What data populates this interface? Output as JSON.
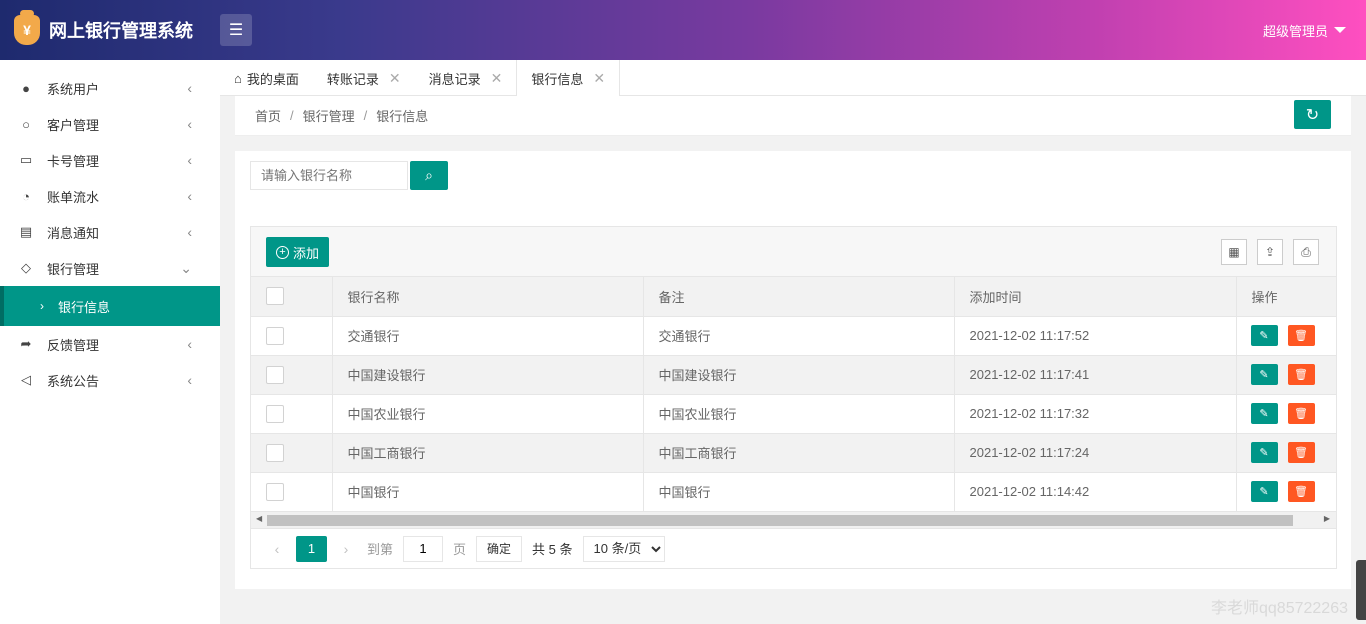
{
  "app": {
    "title": "网上银行管理系统",
    "logo_glyph": "¥"
  },
  "header": {
    "user_label": "超级管理员",
    "menu_icon": "hamburger-icon"
  },
  "sidebar": {
    "items": [
      {
        "label": "系统用户",
        "icon": "user-icon"
      },
      {
        "label": "客户管理",
        "icon": "customer-icon"
      },
      {
        "label": "卡号管理",
        "icon": "card-icon"
      },
      {
        "label": "账单流水",
        "icon": "chart-icon"
      },
      {
        "label": "消息通知",
        "icon": "message-icon"
      },
      {
        "label": "银行管理",
        "icon": "box-icon",
        "expanded": true
      },
      {
        "label": "反馈管理",
        "icon": "share-icon"
      },
      {
        "label": "系统公告",
        "icon": "speaker-icon"
      }
    ],
    "active_sub": {
      "label": "银行信息"
    }
  },
  "tabs": [
    {
      "label": "我的桌面",
      "closable": false
    },
    {
      "label": "转账记录",
      "closable": true
    },
    {
      "label": "消息记录",
      "closable": true
    },
    {
      "label": "银行信息",
      "closable": true,
      "active": true
    }
  ],
  "breadcrumb": {
    "items": [
      "首页",
      "银行管理",
      "银行信息"
    ],
    "sep": "/"
  },
  "search": {
    "placeholder": "请输入银行名称"
  },
  "toolbar": {
    "add_label": "添加"
  },
  "table": {
    "columns": [
      "银行名称",
      "备注",
      "添加时间",
      "操作"
    ],
    "rows": [
      {
        "name": "交通银行",
        "note": "交通银行",
        "time": "2021-12-02 11:17:52"
      },
      {
        "name": "中国建设银行",
        "note": "中国建设银行",
        "time": "2021-12-02 11:17:41"
      },
      {
        "name": "中国农业银行",
        "note": "中国农业银行",
        "time": "2021-12-02 11:17:32"
      },
      {
        "name": "中国工商银行",
        "note": "中国工商银行",
        "time": "2021-12-02 11:17:24"
      },
      {
        "name": "中国银行",
        "note": "中国银行",
        "time": "2021-12-02 11:14:42"
      }
    ]
  },
  "pager": {
    "current": "1",
    "goto_label": "到第",
    "goto_value": "1",
    "unit": "页",
    "confirm": "确定",
    "total": "共 5 条",
    "page_size": "10 条/页"
  },
  "watermark": "李老师qq85722263",
  "colors": {
    "primary": "#009688",
    "danger": "#ff5722"
  }
}
